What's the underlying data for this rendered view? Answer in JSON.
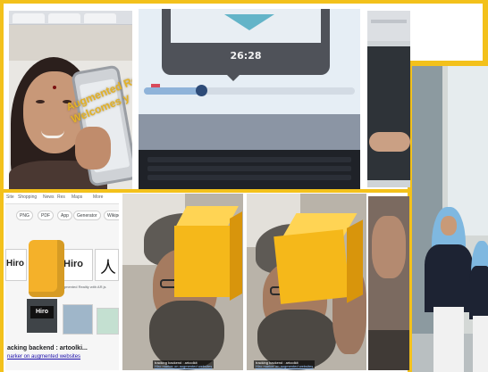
{
  "collage": {
    "description_free": true,
    "accent_color": "#f3c11b"
  },
  "tile_selfie": {
    "overlay_text_line1": "Augmented Re",
    "overlay_text_line2": "Welcomes y"
  },
  "tile_laptop_timer": {
    "timer": "26:28",
    "progress_fraction": 0.27
  },
  "tile_search": {
    "nav_items": [
      "Site",
      "Shopping",
      "News",
      "Res",
      "Maps",
      "More"
    ],
    "chips": [
      "PNG",
      "PDF",
      "App",
      "Generator",
      "Wikipedia"
    ],
    "hiro_text": "Hiro",
    "kanji": "人",
    "result_snippet": "Augmented Reality with AR.js",
    "result_title": "acking backend : artoolki...",
    "result_link": "narker on augmented websites"
  },
  "tile_man_1": {
    "caption_name": "tracking backend : artoolkit",
    "caption_link": "Hiro marker on augmented websites"
  },
  "tile_man_2": {
    "caption_name": "tracking backend : artoolkit",
    "caption_link": "Hiro marker on augmented websites"
  }
}
